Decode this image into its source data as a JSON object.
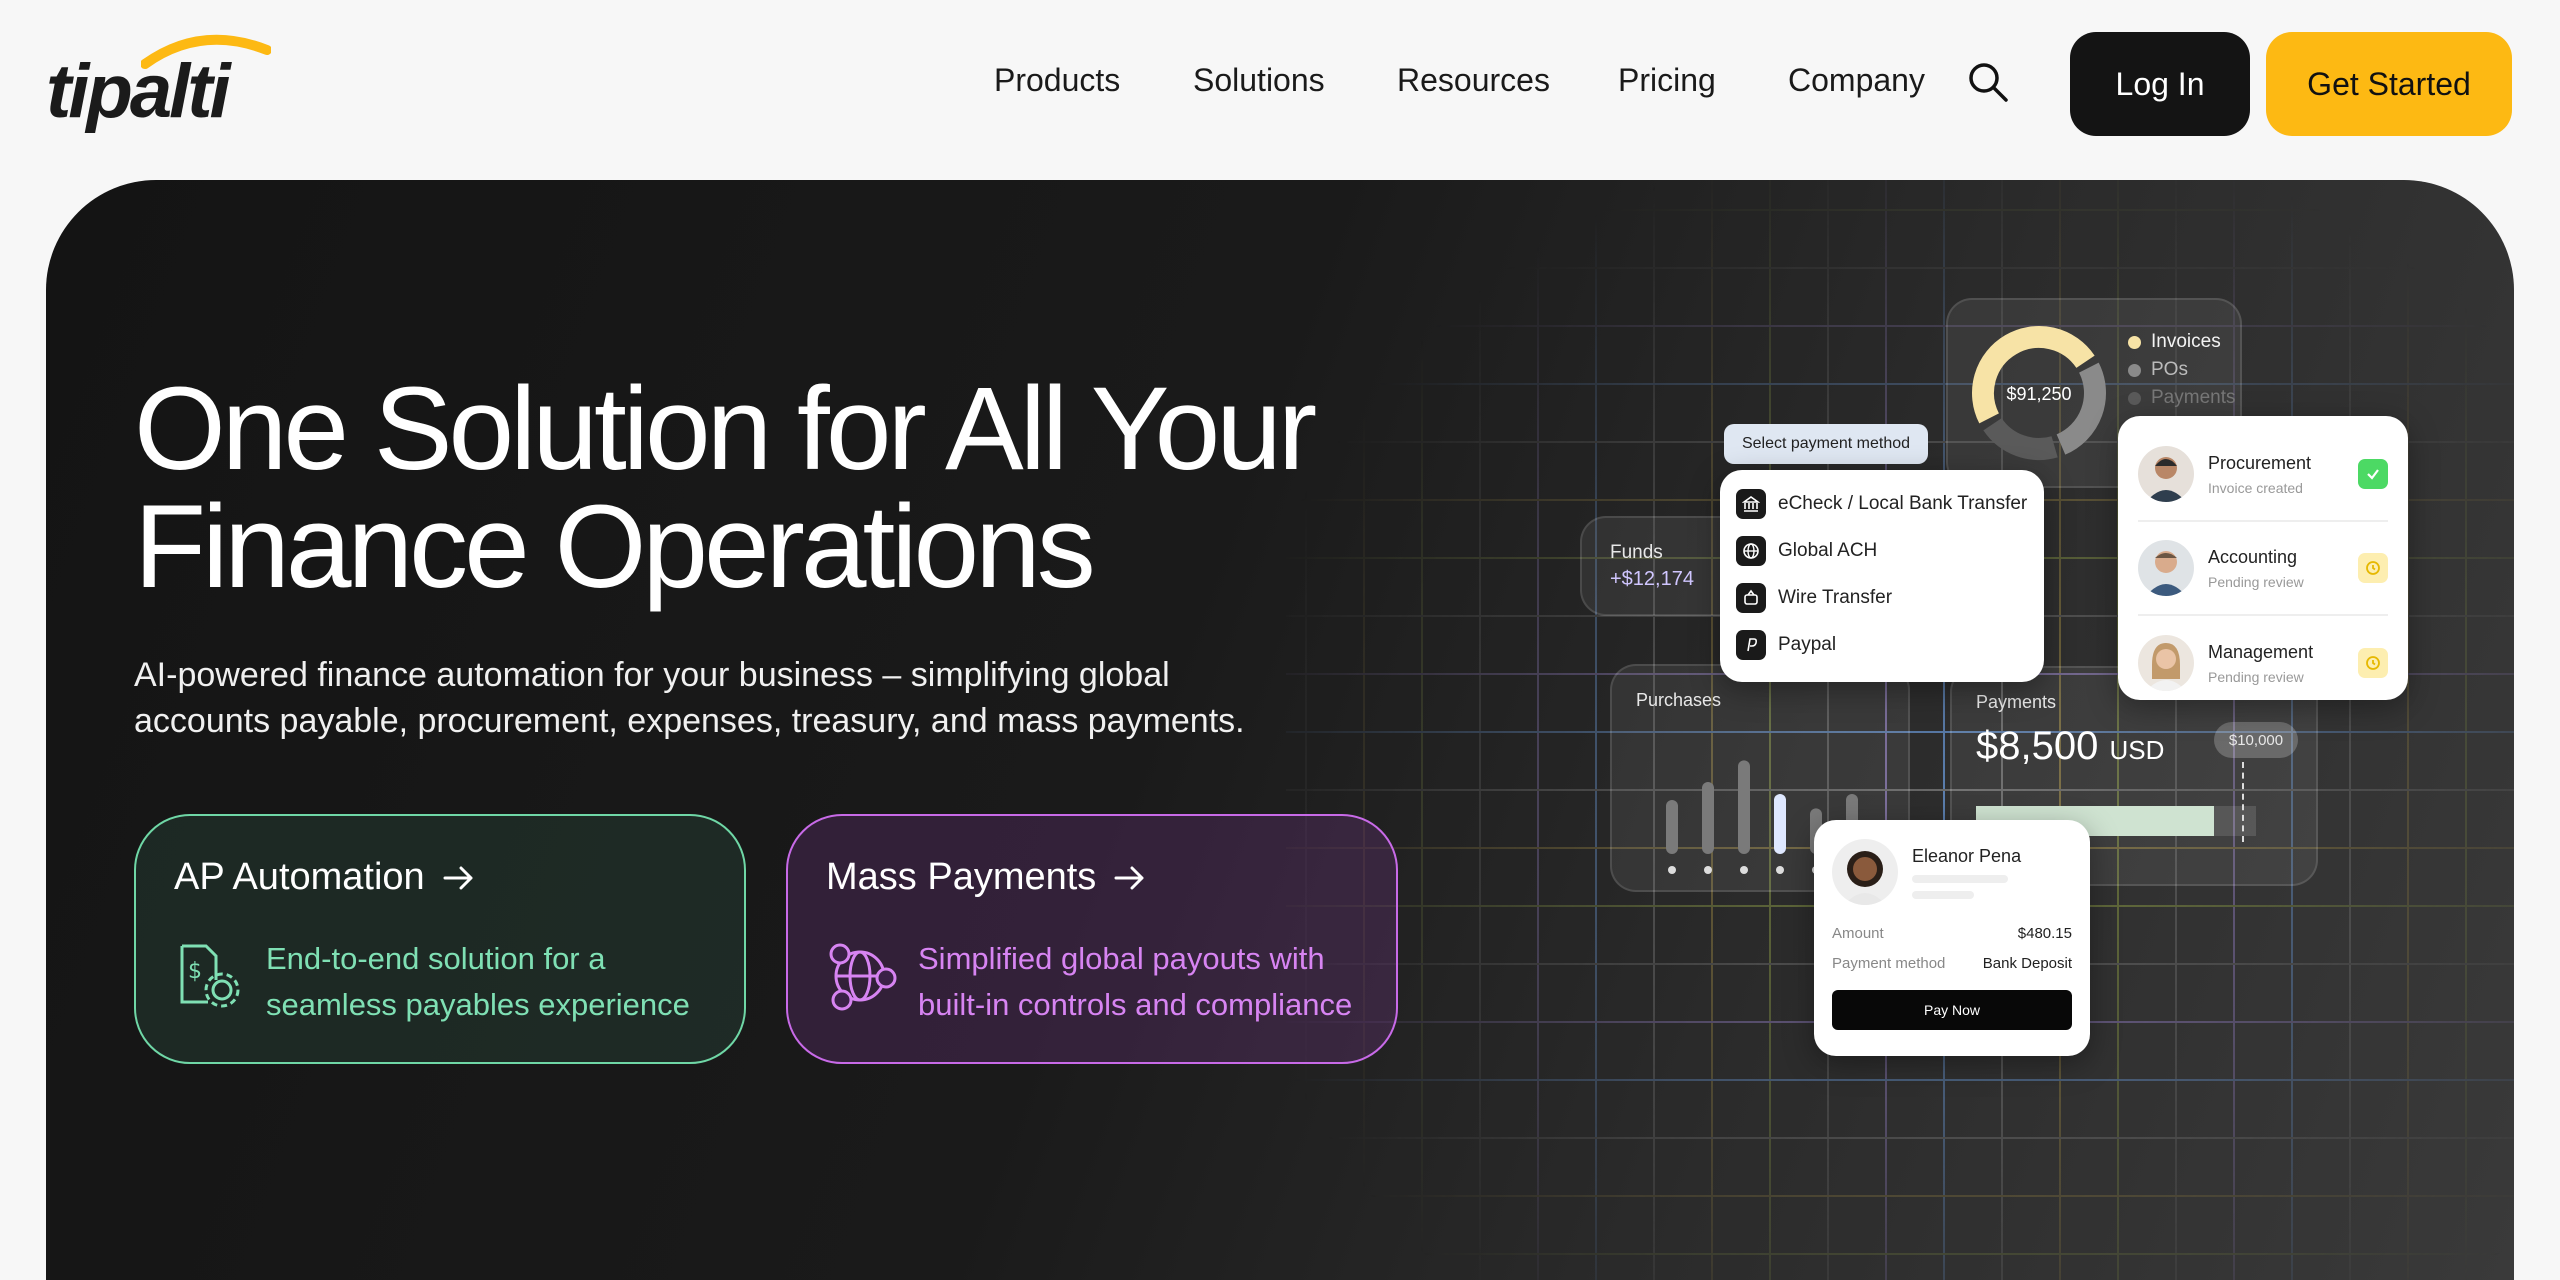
{
  "brand": {
    "logo_text": "tipalti",
    "accent": "#fdb913",
    "dark": "#141414"
  },
  "nav": {
    "items": [
      "Products",
      "Solutions",
      "Resources",
      "Pricing",
      "Company"
    ],
    "login": "Log In",
    "get_started": "Get Started"
  },
  "hero": {
    "title_line1": "One Solution for All Your",
    "title_line2": "Finance Operations",
    "subtitle_line1": "AI-powered finance automation for your business – simplifying global",
    "subtitle_line2": "accounts payable, procurement, expenses, treasury, and mass payments."
  },
  "cards": {
    "ap": {
      "title": "AP Automation",
      "desc_line1": "End-to-end solution for a",
      "desc_line2": "seamless payables experience",
      "color": "#6fd7a6"
    },
    "mp": {
      "title": "Mass Payments",
      "desc_line1": "Simplified global payouts with",
      "desc_line2": "built-in controls and compliance",
      "color": "#c86ae8"
    }
  },
  "widgets": {
    "donut": {
      "center_value": "$91,250",
      "legend": [
        {
          "label": "Invoices",
          "color": "#f7e3a6",
          "share": 0.5
        },
        {
          "label": "POs",
          "color": "#8a8a8a",
          "share": 0.28
        },
        {
          "label": "Payments",
          "color": "#5a5a5a",
          "share": 0.22
        }
      ]
    },
    "payment_method": {
      "pill": "Select payment method",
      "options": [
        "eCheck / Local Bank Transfer",
        "Global ACH",
        "Wire Transfer",
        "Paypal"
      ]
    },
    "funds": {
      "label": "Funds",
      "value": "+$12,174"
    },
    "approvals": [
      {
        "name": "Procurement",
        "status": "Invoice created",
        "state": "done"
      },
      {
        "name": "Accounting",
        "status": "Pending review",
        "state": "pending"
      },
      {
        "name": "Management",
        "status": "Pending review",
        "state": "pending"
      }
    ],
    "purchases": {
      "label": "Purchases",
      "bar_levels": [
        0.45,
        0.6,
        0.78,
        0.5,
        0.38,
        0.5
      ]
    },
    "payments": {
      "label": "Payments",
      "amount": "$8,500",
      "currency": "USD",
      "limit": "$10,000",
      "progress": 0.85
    },
    "payee": {
      "name": "Eleanor Pena",
      "amount_label": "Amount",
      "amount_value": "$480.15",
      "method_label": "Payment method",
      "method_value": "Bank Deposit",
      "button": "Pay Now"
    }
  }
}
